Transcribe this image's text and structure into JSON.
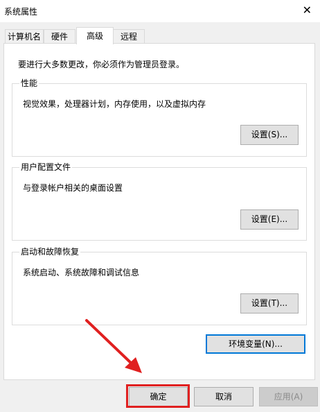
{
  "window": {
    "title": "系统属性"
  },
  "tabs": [
    {
      "label": "计算机名"
    },
    {
      "label": "硬件"
    },
    {
      "label": "高级"
    },
    {
      "label": "远程"
    }
  ],
  "intro_text": "要进行大多数更改，你必须作为管理员登录。",
  "groups": {
    "performance": {
      "title": "性能",
      "description": "视觉效果，处理器计划，内存使用，以及虚拟内存",
      "button": "设置(S)..."
    },
    "user_profiles": {
      "title": "用户配置文件",
      "description": "与登录帐户相关的桌面设置",
      "button": "设置(E)..."
    },
    "startup_recovery": {
      "title": "启动和故障恢复",
      "description": "系统启动、系统故障和调试信息",
      "button": "设置(T)..."
    }
  },
  "env_button": "环境变量(N)...",
  "footer": {
    "ok": "确定",
    "cancel": "取消",
    "apply": "应用(A)"
  },
  "colors": {
    "annotation": "#e02020",
    "focus": "#0078d7"
  },
  "icons": {
    "close": "close-icon"
  }
}
